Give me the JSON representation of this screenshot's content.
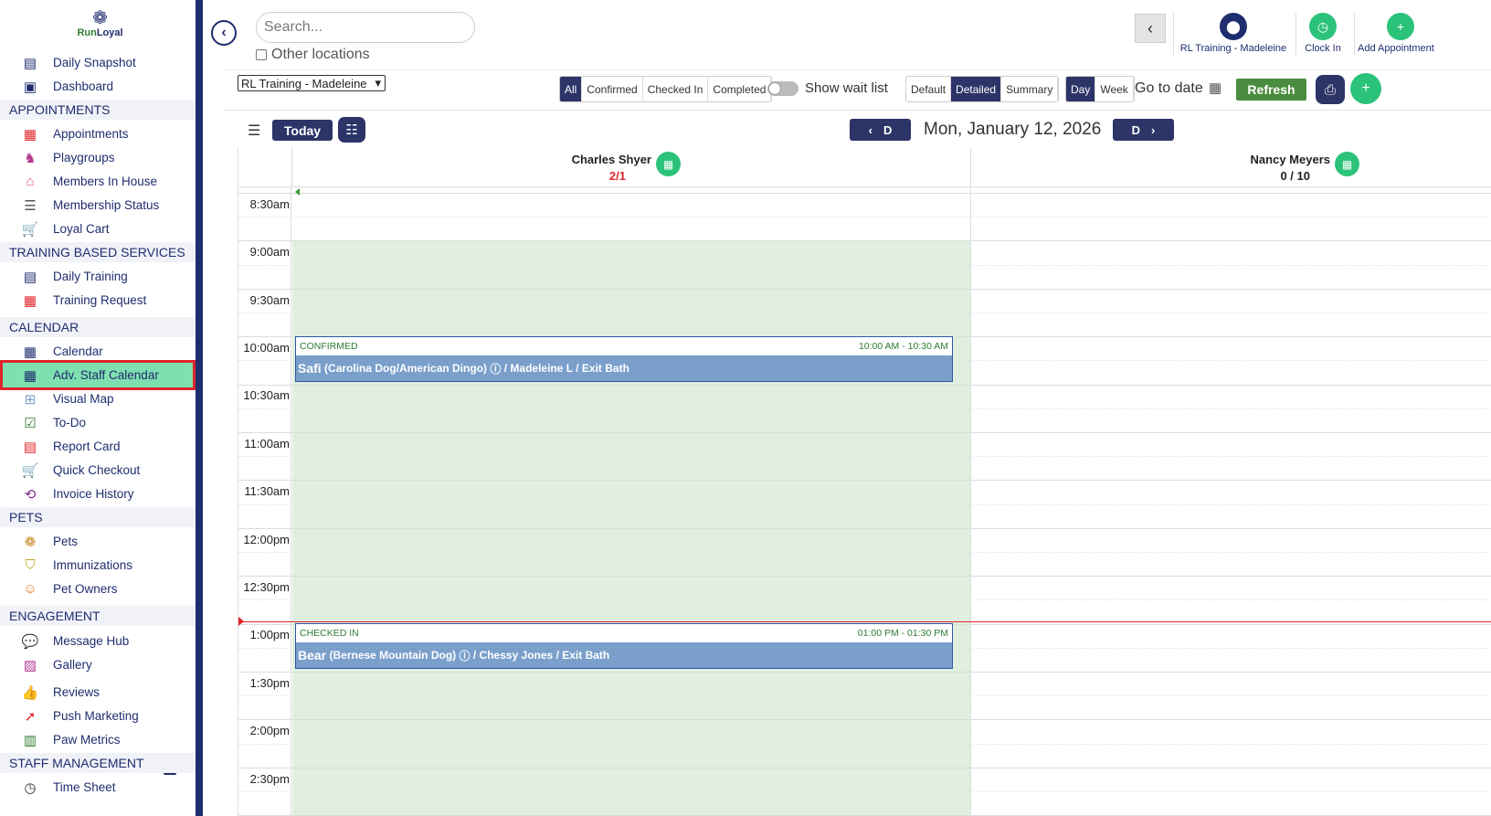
{
  "brand": {
    "name_part1": "Run",
    "name_part2": "Loyal"
  },
  "sidebar": {
    "items": [
      {
        "label": "Daily Snapshot",
        "icon": "today-icon"
      },
      {
        "label": "Dashboard",
        "icon": "dashboard-icon"
      }
    ],
    "sections": [
      {
        "title": "APPOINTMENTS",
        "items": [
          "Appointments",
          "Playgroups",
          "Members In House",
          "Membership Status",
          "Loyal Cart"
        ]
      },
      {
        "title": "TRAINING BASED SERVICES",
        "items": [
          "Daily Training",
          "Training Request"
        ]
      },
      {
        "title": "CALENDAR",
        "items": [
          "Calendar",
          "Adv. Staff Calendar",
          "Visual Map",
          "To-Do",
          "Report Card",
          "Quick Checkout",
          "Invoice History"
        ]
      },
      {
        "title": "PETS",
        "items": [
          "Pets",
          "Immunizations",
          "Pet Owners"
        ]
      },
      {
        "title": "ENGAGEMENT",
        "items": [
          "Message Hub",
          "Gallery",
          "Reviews",
          "Push Marketing",
          "Paw Metrics"
        ]
      },
      {
        "title": "STAFF MANAGEMENT",
        "items": [
          "Time Sheet"
        ]
      }
    ],
    "active": "Adv. Staff Calendar",
    "active_color": "#7ee0b0"
  },
  "header": {
    "search_placeholder": "Search...",
    "other_locations": "Other locations",
    "location_name": "RL Training - Madeleine",
    "clock_in": "Clock In",
    "add_appointment": "Add Appointment"
  },
  "toolbar": {
    "location_select": "RL Training - Madeleine",
    "status_filters": [
      "All",
      "Confirmed",
      "Checked In",
      "Completed"
    ],
    "status_active": "All",
    "show_wait_list": "Show wait list",
    "view_modes": [
      "Default",
      "Detailed",
      "Summary"
    ],
    "view_active": "Detailed",
    "range_modes": [
      "Day",
      "Week"
    ],
    "range_active": "Day",
    "go_to_date": "Go to date",
    "refresh": "Refresh"
  },
  "calendar": {
    "today": "Today",
    "prev": "D",
    "next": "D",
    "current_date": "Mon, January 12, 2026",
    "staff": [
      {
        "name": "Charles Shyer",
        "count": "2/1",
        "count_color": "#e0252a"
      },
      {
        "name": "Nancy Meyers",
        "count": "0 / 10",
        "count_color": "#222"
      }
    ],
    "times": [
      "8:30am",
      "9:00am",
      "9:30am",
      "10:00am",
      "10:30am",
      "11:00am",
      "11:30am",
      "12:00pm",
      "12:30pm",
      "1:00pm",
      "1:30pm",
      "2:00pm",
      "2:30pm"
    ],
    "appointments": [
      {
        "status": "CONFIRMED",
        "time": "10:00 AM - 10:30 AM",
        "pet": "Safi",
        "breed": "(Carolina Dog/American Dingo)",
        "details": "/ Madeleine L / Exit Bath"
      },
      {
        "status": "CHECKED IN",
        "time": "01:00 PM - 01:30 PM",
        "pet": "Bear",
        "breed": "(Bernese Mountain Dog)",
        "details": "/ Chessy Jones / Exit Bath"
      }
    ],
    "shade_color": "#e0efe0",
    "appt_color": "#7a9fcb",
    "accent": "#2c3468"
  }
}
